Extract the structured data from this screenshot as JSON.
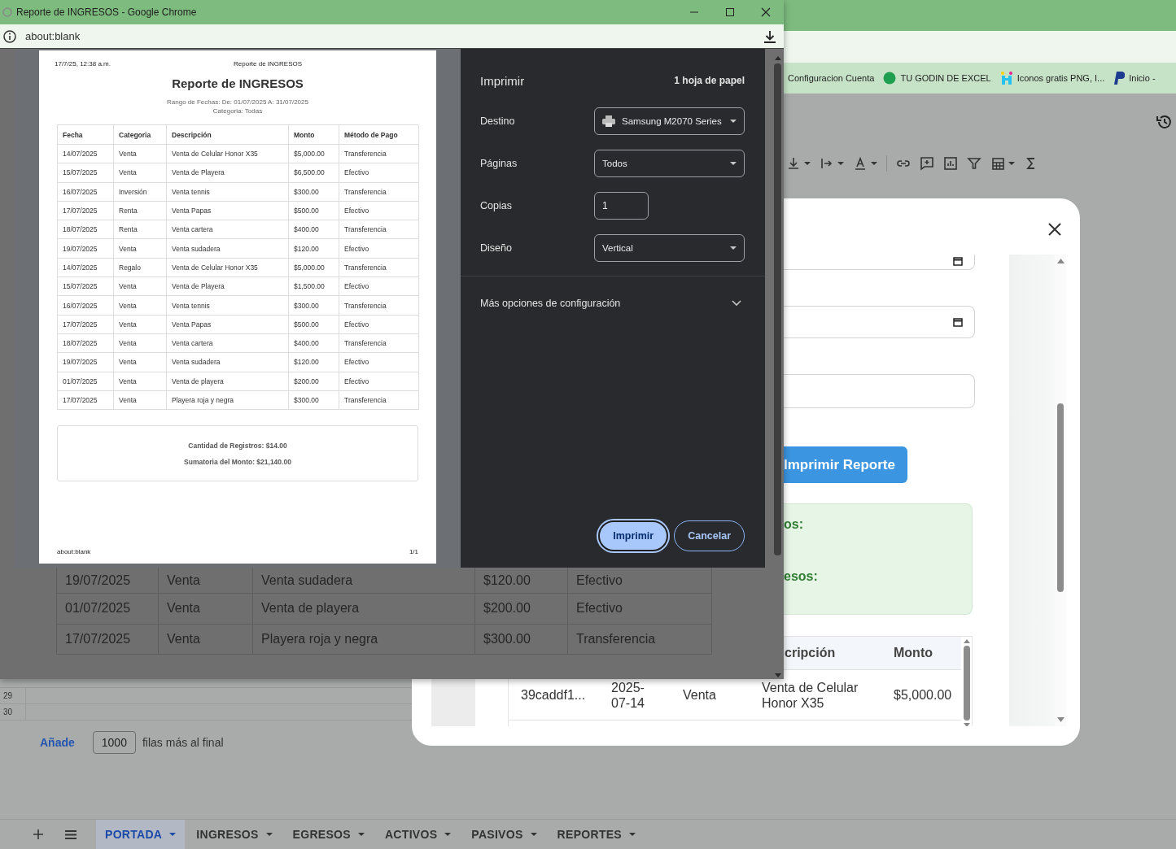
{
  "popup": {
    "title": "Reporte de INGRESOS - Google Chrome",
    "url": "about:blank"
  },
  "preview": {
    "header_date": "17/7/25, 12:38 a.m.",
    "header_title": "Reporte de INGRESOS",
    "title": "Reporte de INGRESOS",
    "range": "Rango de Fechas: De: 01/07/2025 A: 31/07/2025",
    "category": "Categoria: Todas",
    "columns": [
      "Fecha",
      "Categoria",
      "Descripción",
      "Monto",
      "Método de Pago"
    ],
    "rows": [
      [
        "14/07/2025",
        "Venta",
        "Venta de Celular Honor X35",
        "$5,000.00",
        "Transferencia"
      ],
      [
        "15/07/2025",
        "Venta",
        "Venta de Playera",
        "$6,500.00",
        "Efectivo"
      ],
      [
        "16/07/2025",
        "Inversión",
        "Venta tennis",
        "$300.00",
        "Transferencia"
      ],
      [
        "17/07/2025",
        "Renta",
        "Venta Papas",
        "$500.00",
        "Efectivo"
      ],
      [
        "18/07/2025",
        "Renta",
        "Venta cartera",
        "$400.00",
        "Transferencia"
      ],
      [
        "19/07/2025",
        "Venta",
        "Venta sudadera",
        "$120.00",
        "Efectivo"
      ],
      [
        "14/07/2025",
        "Regalo",
        "Venta de Celular Honor X35",
        "$5,000.00",
        "Transferencia"
      ],
      [
        "15/07/2025",
        "Venta",
        "Venta de Playera",
        "$1,500.00",
        "Efectivo"
      ],
      [
        "16/07/2025",
        "Venta",
        "Venta tennis",
        "$300.00",
        "Transferencia"
      ],
      [
        "17/07/2025",
        "Venta",
        "Venta Papas",
        "$500.00",
        "Efectivo"
      ],
      [
        "18/07/2025",
        "Venta",
        "Venta cartera",
        "$400.00",
        "Transferencia"
      ],
      [
        "19/07/2025",
        "Venta",
        "Venta sudadera",
        "$120.00",
        "Efectivo"
      ],
      [
        "01/07/2025",
        "Venta",
        "Venta de playera",
        "$200.00",
        "Efectivo"
      ],
      [
        "17/07/2025",
        "Venta",
        "Playera roja y negra",
        "$300.00",
        "Transferencia"
      ]
    ],
    "summary": [
      "Cantidad de Registros: $14.00",
      "Sumatoria del Monto: $21,140.00"
    ],
    "footer_url": "about:blank",
    "footer_page": "1/1"
  },
  "print": {
    "title": "Imprimir",
    "sheets": "1 hoja de papel",
    "settings": [
      {
        "label": "Destino",
        "kind": "printer",
        "value": "Samsung M2070 Series"
      },
      {
        "label": "Páginas",
        "kind": "select",
        "value": "Todos"
      },
      {
        "label": "Copias",
        "kind": "number",
        "value": "1"
      },
      {
        "label": "Diseño",
        "kind": "select",
        "value": "Vertical"
      }
    ],
    "more": "Más opciones de configuración",
    "buttons": [
      {
        "label": "Imprimir",
        "kind": "primary"
      },
      {
        "label": "Cancelar",
        "kind": "secondary"
      }
    ]
  },
  "report_page": {
    "rows": [
      [
        "19/07/2025",
        "Venta",
        "Venta sudadera",
        "$120.00",
        "Efectivo"
      ],
      [
        "01/07/2025",
        "Venta",
        "Venta de playera",
        "$200.00",
        "Efectivo"
      ],
      [
        "17/07/2025",
        "Venta",
        "Playera roja y negra",
        "$300.00",
        "Transferencia"
      ]
    ]
  },
  "bookmarks": [
    {
      "label": "Configuracion Cuenta",
      "kind": "plain"
    },
    {
      "label": "TU GODIN DE EXCEL",
      "kind": "circle"
    },
    {
      "label": "Iconos gratis PNG, I...",
      "kind": "bars"
    },
    {
      "label": "Inicio -",
      "kind": "shape"
    }
  ],
  "modal": {
    "fields": [
      {
        "kind": "date"
      },
      {
        "kind": "date"
      },
      {
        "kind": "text"
      }
    ],
    "print_button": "Imprimir Reporte",
    "summary": [
      "os:",
      "esos:"
    ],
    "table": {
      "columns": [
        "",
        "",
        "",
        "cripción",
        "Monto"
      ],
      "rows": [
        [
          "39caddf1...",
          "2025-07-14",
          "Venta",
          "Venta de Celular Honor X35",
          "$5,000.00"
        ]
      ]
    }
  },
  "sheet": {
    "row_numbers": [
      "29",
      "30"
    ],
    "add_rows": {
      "link": "Añade",
      "count": "1000",
      "suffix": "filas más al final"
    },
    "tabs": [
      {
        "label": "PORTADA",
        "selected": true
      },
      {
        "label": "INGRESOS",
        "selected": false
      },
      {
        "label": "EGRESOS",
        "selected": false
      },
      {
        "label": "ACTIVOS",
        "selected": false
      },
      {
        "label": "PASIVOS",
        "selected": false
      },
      {
        "label": "REPORTES",
        "selected": false
      }
    ]
  }
}
